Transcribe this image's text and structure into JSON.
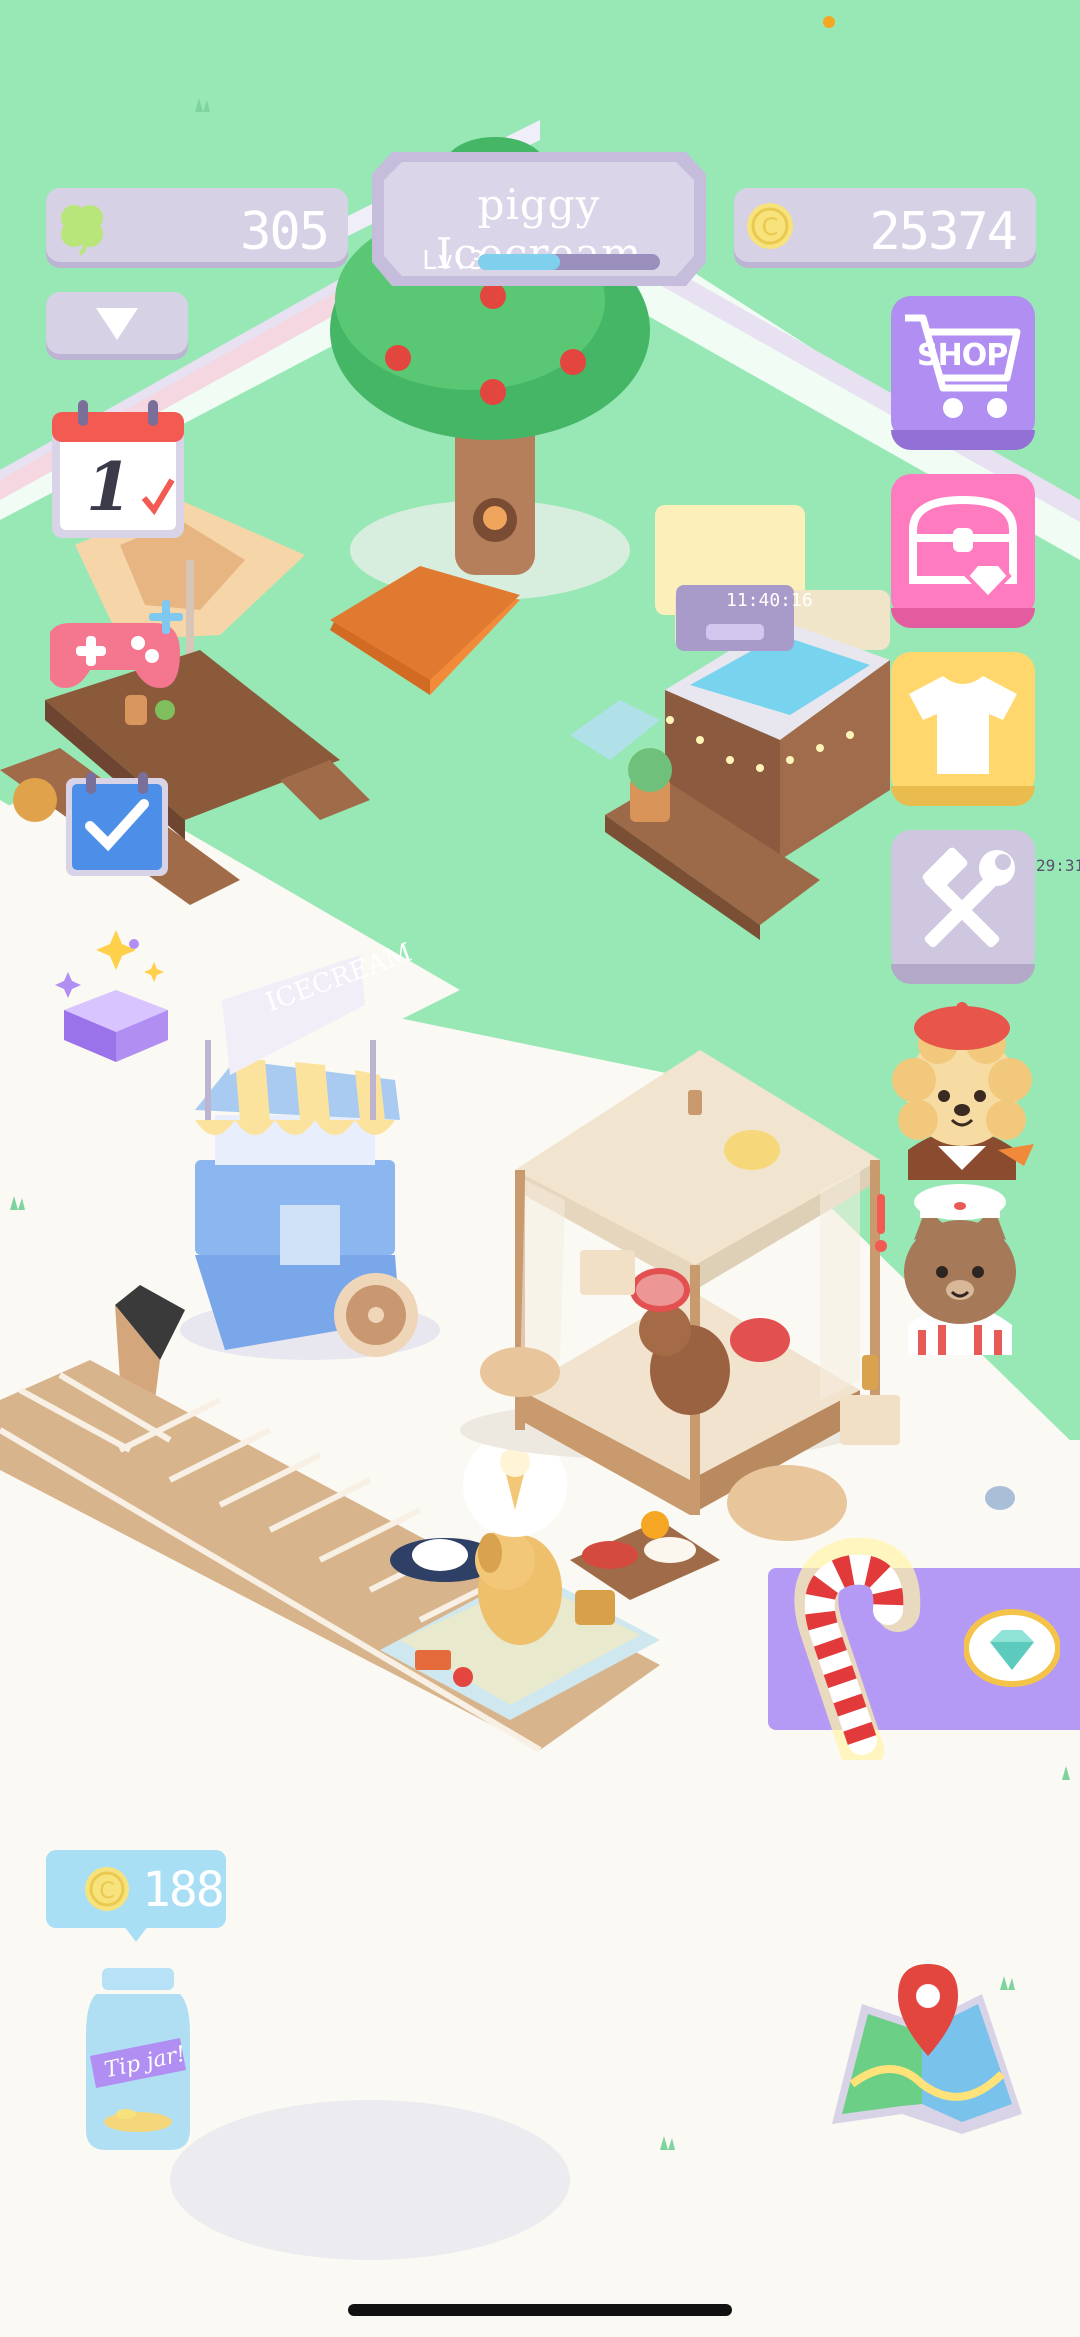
{
  "hud": {
    "clover_count": "305",
    "coin_count": "25374",
    "shop_title": "piggy Icecream",
    "level_label": "Lv.3",
    "level_progress": 0.45
  },
  "buttons": {
    "shop_label": "SHOP"
  },
  "calendar": {
    "day": "1"
  },
  "stand_sign": "ICECREAM",
  "delivery_timer": "11:40:16",
  "side_timer": "29:31",
  "tip_jar": {
    "amount": "188",
    "label": "Tip jar!"
  },
  "colors": {
    "grass": "#98e8b6",
    "floor": "#fbf9f3",
    "hud_panel": "#d7d1e6",
    "shop_button": "#b08ef2",
    "chest_button": "#ff7bbf",
    "wardrobe_button": "#ffd76d",
    "tools_button": "#cfc6df",
    "offer_banner": "#b59af5",
    "coin": "#f7e27c"
  },
  "icons": [
    "clover-icon",
    "coin-icon",
    "dropdown-arrow-icon",
    "shopping-cart-icon",
    "treasure-chest-icon",
    "tshirt-icon",
    "hammer-wrench-icon",
    "calendar-icon",
    "gamepad-icon",
    "checklist-icon",
    "gift-box-icon",
    "map-icon",
    "diamond-icon",
    "candy-cane-icon"
  ]
}
